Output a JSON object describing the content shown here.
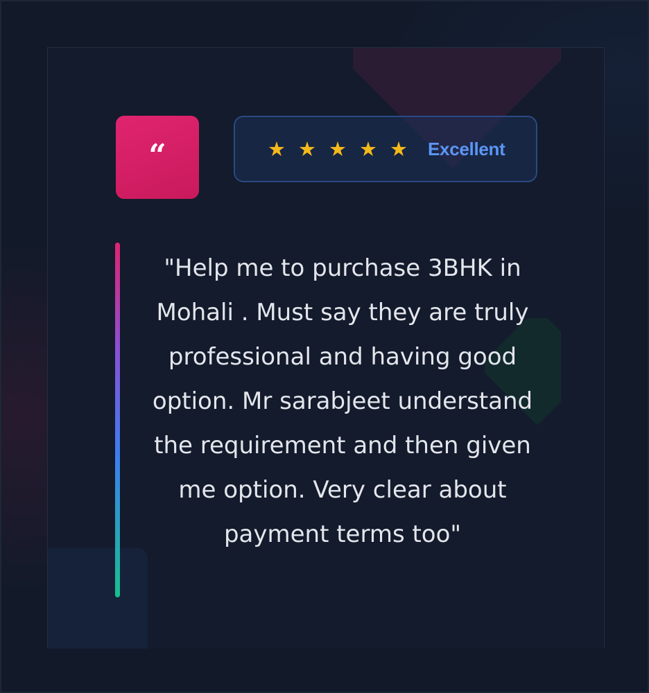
{
  "quote_badge": {
    "glyph": "“",
    "color": "#e0246f"
  },
  "rating": {
    "stars": [
      "★",
      "★",
      "★",
      "★",
      "★"
    ],
    "value": 5,
    "max": 5,
    "label": "Excellent",
    "star_color": "#f6b91b",
    "label_color": "#5b96f5"
  },
  "testimonial": {
    "text": "\"Help me to purchase 3BHK in Mohali . Must say they are truly professional and having good option. Mr sarabjeet understand the requirement and then given me option. Very clear about payment terms too\""
  },
  "colors": {
    "background": "#121a2a",
    "card": "#131b2c",
    "accent_pink": "#e0246f",
    "accent_blue": "#3c7ef0",
    "accent_green": "#18c08e"
  }
}
